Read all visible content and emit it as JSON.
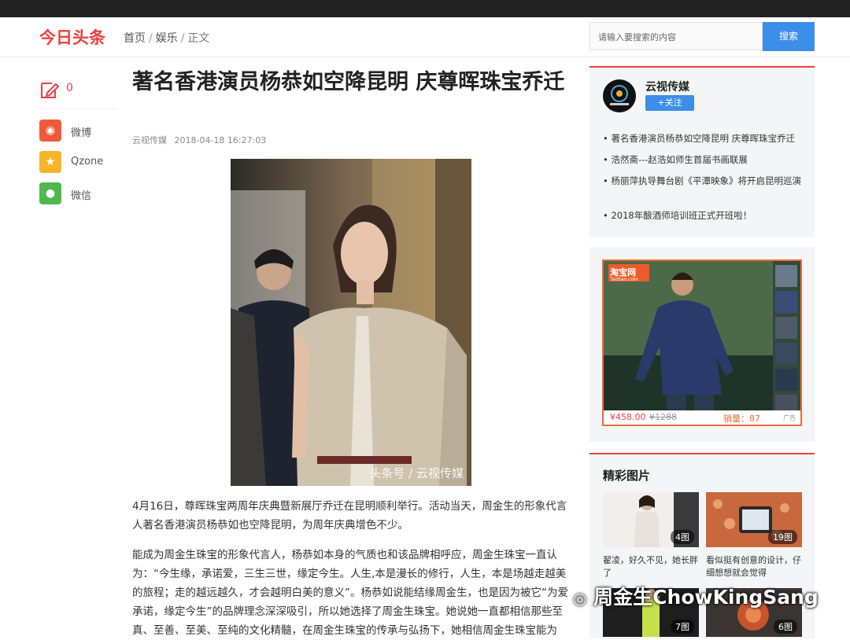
{
  "header": {
    "logo": "今日头条",
    "breadcrumb": [
      "首页",
      "娱乐",
      "正文"
    ],
    "search_placeholder": "请输入要搜索的内容",
    "search_button": "搜索"
  },
  "share": {
    "comment_count": "0",
    "items": [
      {
        "label": "微博",
        "color": "#ef5a3a"
      },
      {
        "label": "Qzone",
        "color": "#f7b52c"
      },
      {
        "label": "微信",
        "color": "#4fba4b"
      }
    ]
  },
  "article": {
    "title": "著名香港演员杨恭如空降昆明 庆尊晖珠宝乔迁",
    "source": "云视传媒",
    "time": "2018-04-18 16:27:03",
    "image_watermark": "头条号 / 云视传媒",
    "paragraphs": [
      "4月16日，尊晖珠宝两周年庆典暨新展厅乔迁在昆明顺利举行。活动当天，周金生的形象代言人著名香港演员杨恭如也空降昆明，为周年庆典增色不少。",
      "能成为周金生珠宝的形象代言人，杨恭如本身的气质也和该品牌相呼应，周金生珠宝一直认为：“今生缘，承诺爱，三生三世，缘定今生。人生,本是漫长的修行，人生，本是场越走越美的旅程；走的越远越久，才会越明白美的意义”。杨恭如说能结缘周金生，也是因为被它“为爱承诺，缘定今生”的品牌理念深深吸引，所以她选择了周金生珠宝。她说她一直都相信那些至真、至善、至美、至纯的文化精髓，在周金生珠宝的传承与弘扬下，她相信周金生珠宝能为"
    ]
  },
  "sidebar": {
    "source_name": "云视传媒",
    "follow_label": "+关注",
    "related": [
      "著名香港演员杨恭如空降昆明 庆尊晖珠宝乔迁",
      "浩然斋---赵浩如师生首届书画联展",
      "杨丽萍执导舞台剧《平潭映象》将开启昆明巡演",
      "2018年酿酒师培训班正式开班啦！"
    ],
    "ad": {
      "badge": "淘宝网",
      "badge_sub": "Taobao.com",
      "price": "¥458.00",
      "old_price": "¥1288",
      "sales": "销量：87",
      "ad_tag": "广告"
    },
    "gallery_title": "精彩图片",
    "gallery": [
      {
        "count": "4图",
        "caption": "翟凌，好久不见，她长胖了"
      },
      {
        "count": "19图",
        "caption": "看似挺有创意的设计，仔细想想就会觉得"
      },
      {
        "count": "7图",
        "caption": ""
      },
      {
        "count": "6图",
        "caption": ""
      }
    ]
  },
  "watermark": "周金生ChowKingSang"
}
